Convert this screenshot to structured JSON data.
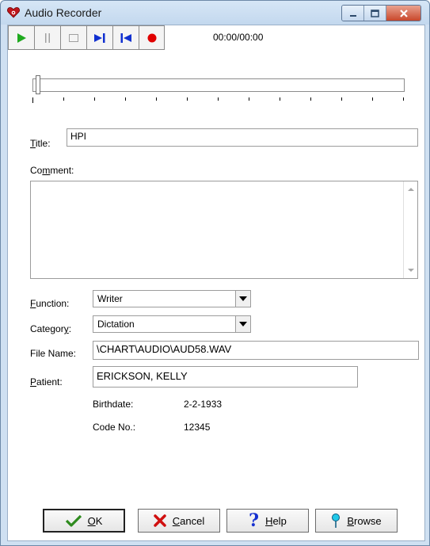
{
  "window": {
    "title": "Audio Recorder"
  },
  "window_controls": {
    "minimize_icon": "minimize-icon",
    "maximize_icon": "maximize-icon",
    "close_icon": "close-icon"
  },
  "toolbar": {
    "buttons": [
      {
        "name": "play",
        "icon": "play-icon",
        "color": "#1faa1f"
      },
      {
        "name": "pause",
        "icon": "pause-icon",
        "color": "#a0a0a0"
      },
      {
        "name": "stop",
        "icon": "stop-icon",
        "color": "#a0a0a0"
      },
      {
        "name": "skip-end",
        "icon": "skip-end-icon",
        "color": "#1030d0"
      },
      {
        "name": "skip-start",
        "icon": "skip-start-icon",
        "color": "#1030d0"
      },
      {
        "name": "record",
        "icon": "record-icon",
        "color": "#e00000"
      }
    ],
    "time": "00:00/00:00"
  },
  "position": {
    "fraction": 0.0
  },
  "title": {
    "label_pre": "",
    "label_ul": "T",
    "label_post": "itle:",
    "value": "HPI"
  },
  "comment": {
    "label_pre": "Co",
    "label_ul": "m",
    "label_post": "ment:",
    "value": ""
  },
  "function": {
    "label_pre": "",
    "label_ul": "F",
    "label_post": "unction:",
    "value": "Writer"
  },
  "category": {
    "label_pre": "Categor",
    "label_ul": "y",
    "label_post": ":",
    "value": "Dictation"
  },
  "file_name": {
    "label": "File Name:",
    "value": "\\CHART\\AUDIO\\AUD58.WAV"
  },
  "patient": {
    "label_pre": "",
    "label_ul": "P",
    "label_post": "atient:",
    "value": "ERICKSON, KELLY"
  },
  "birthdate": {
    "label": "Birthdate:",
    "value": "2-2-1933"
  },
  "code_no": {
    "label": "Code No.:",
    "value": "12345"
  },
  "buttons": {
    "ok": {
      "ul": "O",
      "rest": "K"
    },
    "cancel": {
      "ul": "C",
      "rest": "ancel"
    },
    "help": {
      "ul": "H",
      "rest": "elp"
    },
    "browse": {
      "ul": "B",
      "rest": "rowse"
    }
  }
}
